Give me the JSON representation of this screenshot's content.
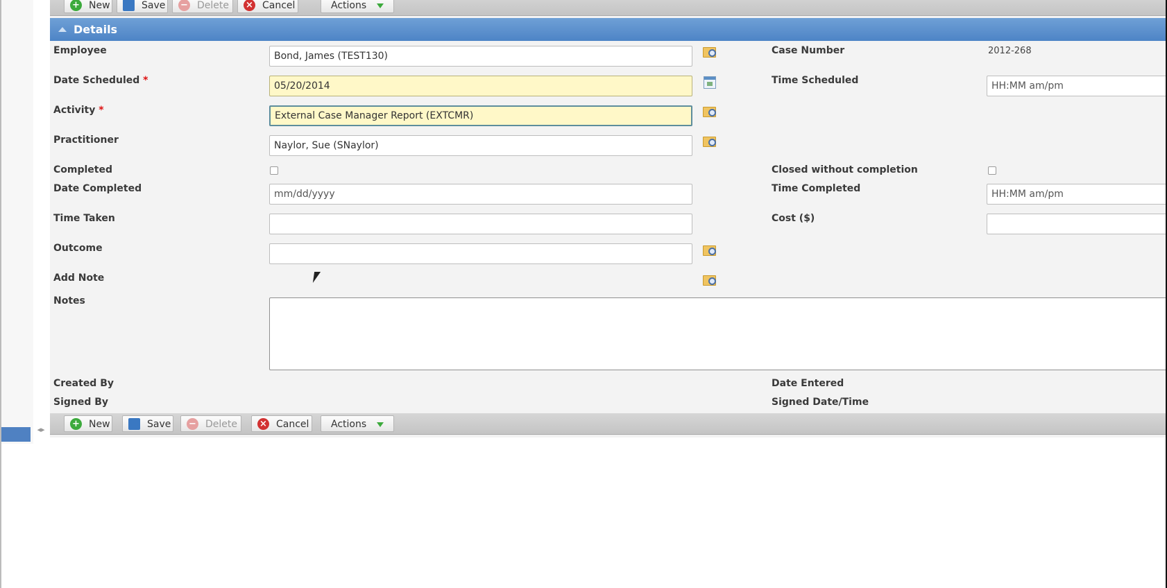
{
  "toolbar": {
    "new_label": "New",
    "save_label": "Save",
    "delete_label": "Delete",
    "cancel_label": "Cancel",
    "actions_label": "Actions"
  },
  "details": {
    "title": "Details",
    "employee_label": "Employee",
    "employee_value": "Bond, James (TEST130)",
    "case_number_label": "Case Number",
    "case_number_value": "2012-268",
    "date_scheduled_label": "Date Scheduled",
    "date_scheduled_value": "05/20/2014",
    "time_scheduled_label": "Time Scheduled",
    "time_scheduled_placeholder": "HH:MM am/pm",
    "activity_label": "Activity",
    "activity_value": "External Case Manager Report (EXTCMR)",
    "practitioner_label": "Practitioner",
    "practitioner_value": "Naylor, Sue (SNaylor)",
    "completed_label": "Completed",
    "completed_checked": false,
    "closed_without_completion_label": "Closed without completion",
    "closed_without_completion_checked": false,
    "date_completed_label": "Date Completed",
    "date_completed_placeholder": "mm/dd/yyyy",
    "time_completed_label": "Time Completed",
    "time_completed_placeholder": "HH:MM am/pm",
    "time_taken_label": "Time Taken",
    "time_taken_value": "",
    "cost_label": "Cost ($)",
    "cost_value": "",
    "outcome_label": "Outcome",
    "outcome_value": "",
    "add_note_label": "Add Note",
    "notes_label": "Notes",
    "notes_value": "",
    "created_by_label": "Created By",
    "date_entered_label": "Date Entered",
    "signed_by_label": "Signed By",
    "signed_datetime_label": "Signed Date/Time",
    "required_marker": "*"
  },
  "icons": {
    "lookup": "folder-search-icon",
    "calendar": "calendar-icon",
    "collapse": "collapse-triangle-icon",
    "splitter": "splitter-arrows-icon"
  },
  "colors": {
    "header_blue": "#4d84c6",
    "required_field_bg": "#fff8c8",
    "required_marker": "#d11111",
    "new_green": "#3caa3c",
    "cancel_red": "#d23232"
  }
}
